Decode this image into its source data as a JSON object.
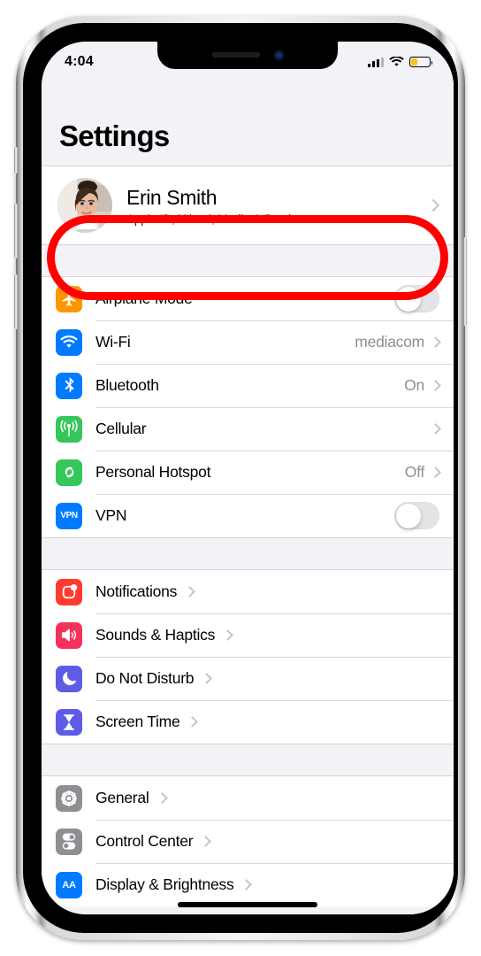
{
  "device": {
    "name": "iphone-x-silver"
  },
  "status_bar": {
    "time": "4:04",
    "signal_icon": "cellular-signal-icon",
    "signal_bars_filled": 3,
    "signal_bars_total": 4,
    "wifi_icon": "wifi-icon",
    "battery_icon": "battery-icon",
    "battery_level_percent": 35,
    "battery_color": "#f5c518"
  },
  "page": {
    "title": "Settings"
  },
  "profile": {
    "name": "Erin Smith",
    "subtitle": "Apple ID, iCloud, Media & Purchases",
    "avatar_icon": "avatar",
    "chevron_icon": "chevron-right-icon",
    "highlighted": true,
    "highlight_color": "#ff0000"
  },
  "groups": [
    {
      "id": "connectivity",
      "rows": [
        {
          "label": "Airplane Mode",
          "icon": "airplane-icon",
          "icon_color": "#ff9500",
          "control": "toggle",
          "toggle_on": false
        },
        {
          "label": "Wi-Fi",
          "icon": "wifi-icon",
          "icon_color": "#007aff",
          "control": "value",
          "value": "mediacom"
        },
        {
          "label": "Bluetooth",
          "icon": "bluetooth-icon",
          "icon_color": "#007aff",
          "control": "value",
          "value": "On"
        },
        {
          "label": "Cellular",
          "icon": "cellular-icon",
          "icon_color": "#34c759",
          "control": "value",
          "value": ""
        },
        {
          "label": "Personal Hotspot",
          "icon": "hotspot-icon",
          "icon_color": "#34c759",
          "control": "value",
          "value": "Off"
        },
        {
          "label": "VPN",
          "icon": "vpn-icon",
          "icon_color": "#007aff",
          "control": "toggle",
          "toggle_on": false
        }
      ]
    },
    {
      "id": "alerts",
      "rows": [
        {
          "label": "Notifications",
          "icon": "notifications-icon",
          "icon_color": "#ff3b30",
          "control": "value",
          "value": ""
        },
        {
          "label": "Sounds & Haptics",
          "icon": "sounds-icon",
          "icon_color": "#f4325a",
          "control": "value",
          "value": ""
        },
        {
          "label": "Do Not Disturb",
          "icon": "do-not-disturb-icon",
          "icon_color": "#5e5ce6",
          "control": "value",
          "value": ""
        },
        {
          "label": "Screen Time",
          "icon": "screen-time-icon",
          "icon_color": "#5e5ce6",
          "control": "value",
          "value": ""
        }
      ]
    },
    {
      "id": "system",
      "rows": [
        {
          "label": "General",
          "icon": "gear-icon",
          "icon_color": "#8e8e93",
          "control": "value",
          "value": ""
        },
        {
          "label": "Control Center",
          "icon": "control-center-icon",
          "icon_color": "#8e8e93",
          "control": "value",
          "value": ""
        },
        {
          "label": "Display & Brightness",
          "icon": "display-brightness-icon",
          "icon_color": "#007aff",
          "control": "value",
          "value": ""
        }
      ]
    }
  ]
}
